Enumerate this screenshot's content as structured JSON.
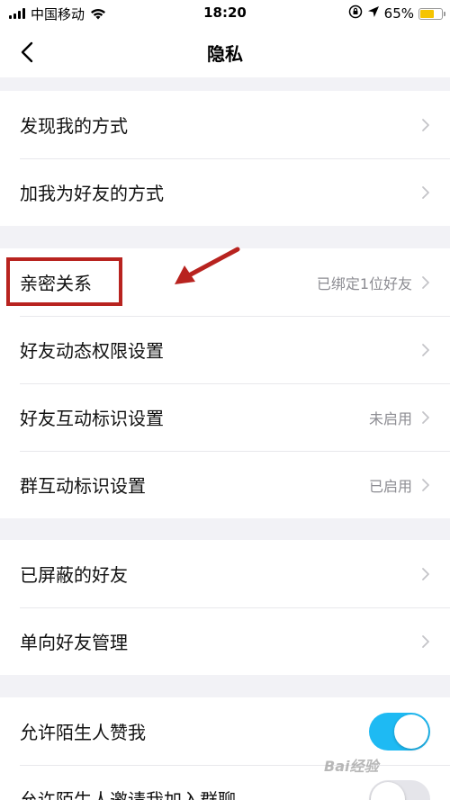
{
  "status_bar": {
    "carrier": "中国移动",
    "time": "18:20",
    "battery_percent": "65%",
    "battery_level": 0.65,
    "battery_color": "#f5c400"
  },
  "nav": {
    "title": "隐私",
    "back_icon": "chevron-left-icon"
  },
  "groups": [
    {
      "items": [
        {
          "label": "发现我的方式",
          "value": ""
        },
        {
          "label": "加我为好友的方式",
          "value": ""
        }
      ]
    },
    {
      "items": [
        {
          "label": "亲密关系",
          "value": "已绑定1位好友"
        },
        {
          "label": "好友动态权限设置",
          "value": ""
        },
        {
          "label": "好友互动标识设置",
          "value": "未启用"
        },
        {
          "label": "群互动标识设置",
          "value": "已启用"
        }
      ]
    },
    {
      "items": [
        {
          "label": "已屏蔽的好友",
          "value": ""
        },
        {
          "label": "单向好友管理",
          "value": ""
        }
      ]
    },
    {
      "items": [
        {
          "label": "允许陌生人赞我",
          "toggle_on": true
        },
        {
          "label": "允许陌生人邀请我加入群聊",
          "toggle_on": false
        }
      ]
    }
  ],
  "colors": {
    "toggle_on": "#1ebaf3",
    "toggle_off": "#e5e5ea",
    "annotation_red": "#b8231f"
  },
  "watermark": "Bai经验"
}
